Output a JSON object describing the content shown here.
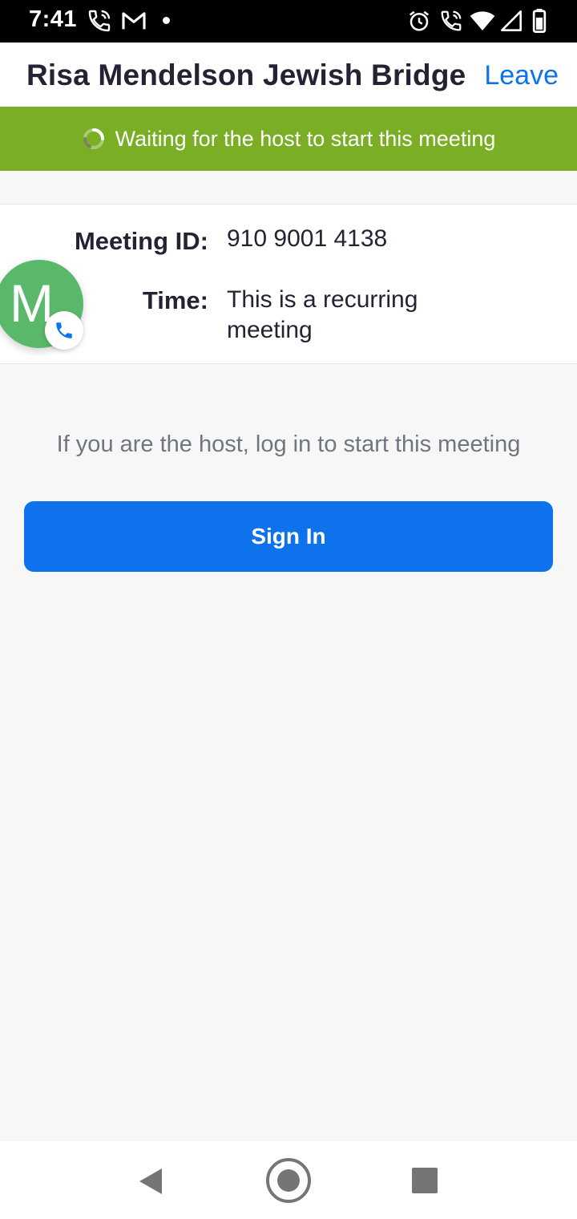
{
  "status_bar": {
    "time": "7:41",
    "left_icons": [
      "wifi-calling-icon",
      "gmail-icon",
      "notification-dot-icon"
    ],
    "right_icons": [
      "alarm-icon",
      "wifi-calling-icon",
      "wifi-icon",
      "signal-icon",
      "battery-icon"
    ]
  },
  "header": {
    "title": "Risa Mendelson Jewish Bridge",
    "leave_label": "Leave"
  },
  "banner": {
    "text": "Waiting for the host to start this meeting",
    "color": "#7aae24"
  },
  "info": {
    "meeting_id_label": "Meeting ID:",
    "meeting_id_value": "910 9001 4138",
    "time_label": "Time:",
    "time_value": "This is a recurring meeting"
  },
  "avatar": {
    "letter": "M",
    "badge_icon": "phone-icon"
  },
  "host_prompt": "If you are the host, log in to start this meeting",
  "sign_in_label": "Sign In",
  "colors": {
    "accent": "#0e72ed",
    "avatar": "#59b86a"
  },
  "nav": {
    "icons": [
      "back-icon",
      "home-icon",
      "recents-icon"
    ]
  }
}
